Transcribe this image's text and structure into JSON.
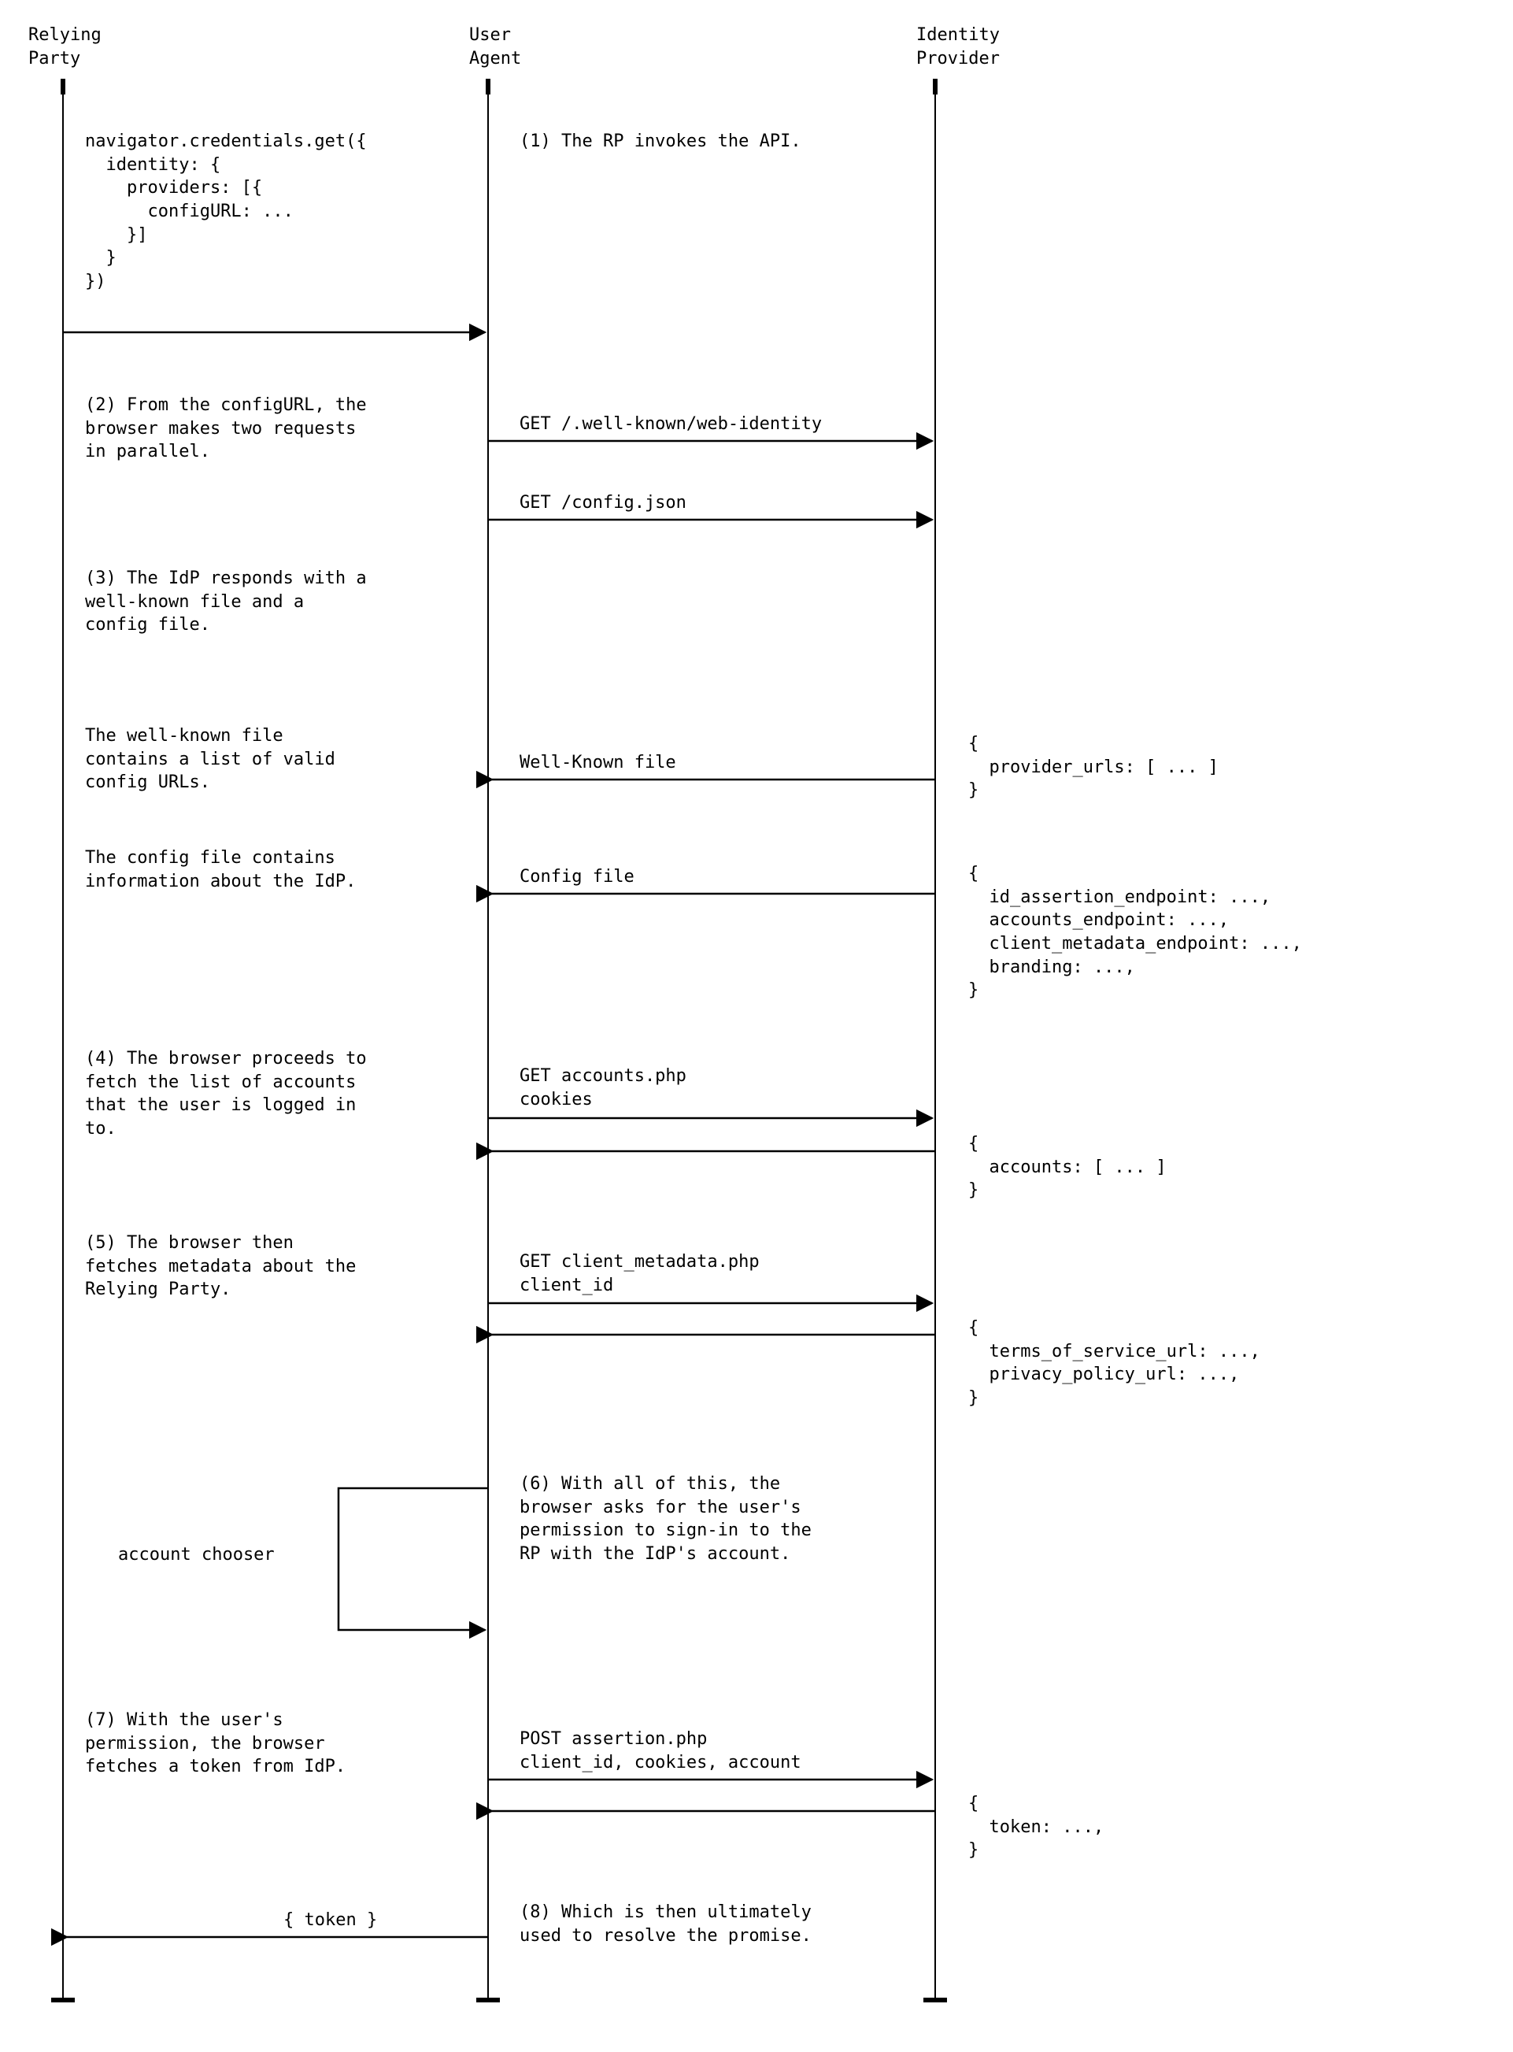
{
  "actors": {
    "rp1": "Relying",
    "rp2": "Party",
    "ua1": "User",
    "ua2": "Agent",
    "idp1": "Identity",
    "idp2": "Provider"
  },
  "code0": "navigator.credentials.get({\n  identity: {\n    providers: [{\n      configURL: ...\n    }]\n  }\n})",
  "step1": "(1) The RP invokes the API.",
  "step2": "(2) From the configURL, the\nbrowser makes two requests\nin parallel.",
  "req2a": "GET /.well-known/web-identity",
  "req2b": "GET /config.json",
  "step3": "(3) The IdP responds with a\nwell-known file and a\nconfig file.",
  "note3a": "The well-known file\ncontains a list of valid\nconfig URLs.",
  "resp3a": "Well-Known file",
  "json3a": "{\n  provider_urls: [ ... ]\n}",
  "note3b": "The config file contains\ninformation about the IdP.",
  "resp3b": "Config file",
  "json3b": "{\n  id_assertion_endpoint: ...,\n  accounts_endpoint: ...,\n  client_metadata_endpoint: ...,\n  branding: ...,\n}",
  "step4": "(4) The browser proceeds to\nfetch the list of accounts\nthat the user is logged in\nto.",
  "req4": "GET accounts.php\ncookies",
  "json4": "{\n  accounts: [ ... ]\n}",
  "step5": "(5) The browser then\nfetches metadata about the\nRelying Party.",
  "req5": "GET client_metadata.php\nclient_id",
  "json5": "{\n  terms_of_service_url: ...,\n  privacy_policy_url: ...,\n}",
  "step6": "(6) With all of this, the\nbrowser asks for the user's\npermission to sign-in to the\nRP with the IdP's account.",
  "selfmsg": "account chooser",
  "step7": "(7) With the user's\npermission, the browser\nfetches a token from IdP.",
  "req7": "POST assertion.php\nclient_id, cookies, account",
  "json7": "{\n  token: ...,\n}",
  "step8": "(8) Which is then ultimately\nused to resolve the promise.",
  "ret8": "{ token }"
}
